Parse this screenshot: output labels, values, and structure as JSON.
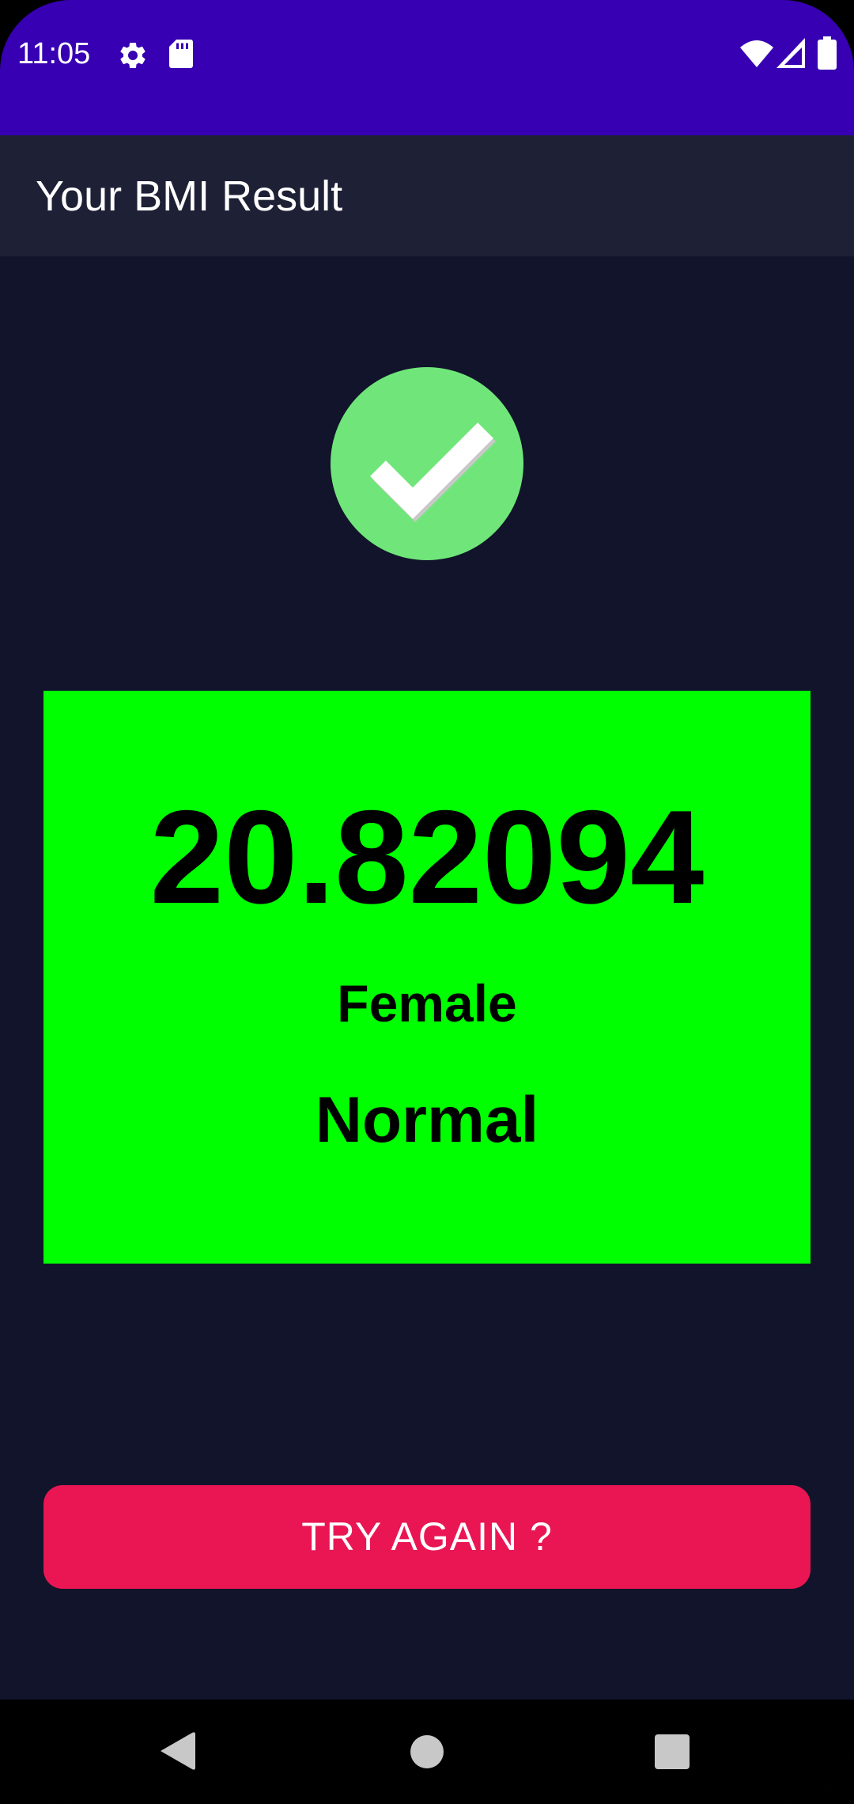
{
  "status_bar": {
    "time": "11:05",
    "icons": [
      "gear-icon",
      "sd-card-icon",
      "wifi-icon",
      "signal-icon",
      "battery-icon"
    ],
    "background_color": "#3700b3"
  },
  "app_bar": {
    "title": "Your BMI Result",
    "background_color": "#1e2035"
  },
  "result": {
    "status_icon": "checkmark-icon",
    "bmi_value": "20.82094",
    "gender": "Female",
    "category": "Normal",
    "card_color": "#00ff00"
  },
  "actions": {
    "try_again_label": "TRY AGAIN ?",
    "button_color": "#e91653"
  },
  "navigation_bar": {
    "buttons": [
      "back-icon",
      "home-icon",
      "recents-icon"
    ]
  }
}
